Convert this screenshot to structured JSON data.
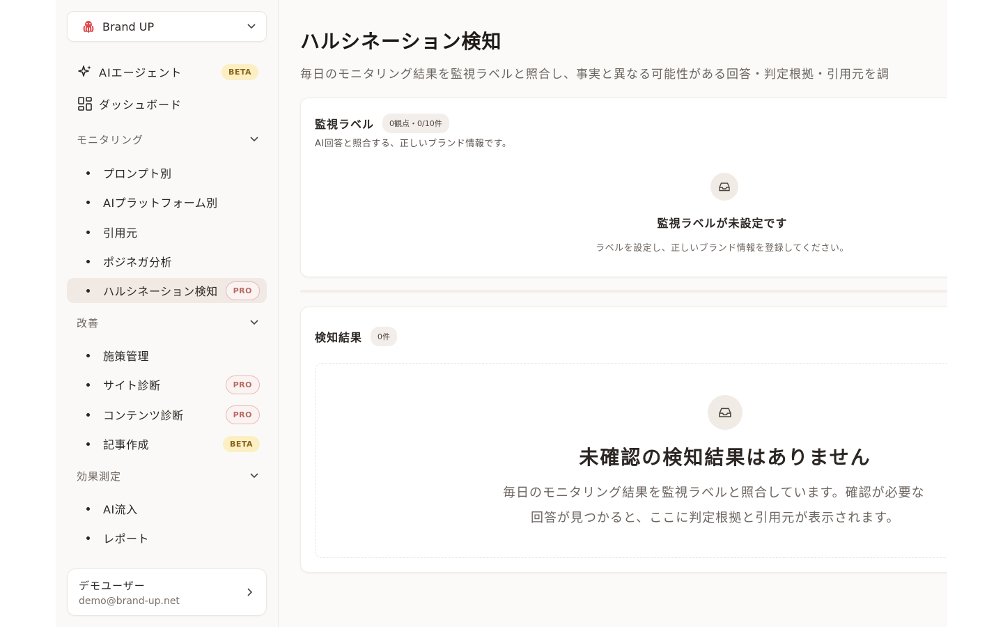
{
  "sidebar": {
    "brand": {
      "name": "Brand UP",
      "logo_icon": "octopus-logo-icon",
      "accent": "#e0464b"
    },
    "top_nav": [
      {
        "label": "AIエージェント",
        "icon": "sparkles-icon",
        "badge": "BETA"
      },
      {
        "label": "ダッシュボード",
        "icon": "grid-icon",
        "badge": ""
      }
    ],
    "sections": [
      {
        "label": "モニタリング",
        "items": [
          {
            "label": "プロンプト別",
            "badge": ""
          },
          {
            "label": "AIプラットフォーム別",
            "badge": ""
          },
          {
            "label": "引用元",
            "badge": ""
          },
          {
            "label": "ポジネガ分析",
            "badge": ""
          },
          {
            "label": "ハルシネーション検知",
            "badge": "PRO",
            "active": true
          }
        ]
      },
      {
        "label": "改善",
        "items": [
          {
            "label": "施策管理",
            "badge": ""
          },
          {
            "label": "サイト診断",
            "badge": "PRO"
          },
          {
            "label": "コンテンツ診断",
            "badge": "PRO"
          },
          {
            "label": "記事作成",
            "badge": "BETA"
          }
        ]
      },
      {
        "label": "効果測定",
        "items": [
          {
            "label": "AI流入",
            "badge": ""
          },
          {
            "label": "レポート",
            "badge": ""
          }
        ]
      }
    ],
    "user": {
      "name": "デモユーザー",
      "email": "demo@brand-up.net"
    }
  },
  "main": {
    "title": "ハルシネーション検知",
    "description": "毎日のモニタリング結果を監視ラベルと照合し、事実と異なる可能性がある回答・判定根拠・引用元を調",
    "labels_card": {
      "title": "監視ラベル",
      "count": "0観点・0/10件",
      "subtitle": "AI回答と照合する、正しいブランド情報です。",
      "empty_icon": "inbox-icon",
      "empty_title": "監視ラベルが未設定です",
      "empty_text": "ラベルを設定し、正しいブランド情報を登録してください。"
    },
    "results_card": {
      "title": "検知結果",
      "count": "0件",
      "empty_icon": "inbox-icon",
      "empty_title": "未確認の検知結果はありません",
      "empty_text_1": "毎日のモニタリング結果を監視ラベルと照合しています。確認が必要な",
      "empty_text_2": "回答が見つかると、ここに判定根拠と引用元が表示されます。"
    }
  }
}
